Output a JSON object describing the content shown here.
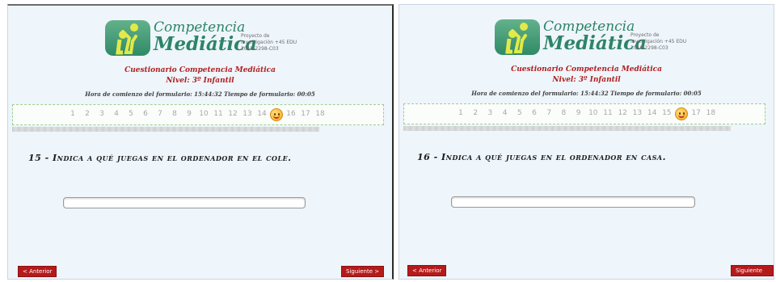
{
  "panels": [
    {
      "logo": {
        "line1": "Competencia",
        "line2": "Mediática",
        "subtitle": "Proyecto de Investigación +45 EDU 2010-2298-C03"
      },
      "questionnaire_title": "Cuestionario Competencia Mediática",
      "level": "Nivel: 3º Infantil",
      "time_line": "Hora de comienzo del formulario: 15:44:32 Tiempo de formulario: 00:05",
      "pages": [
        "1",
        "2",
        "3",
        "4",
        "5",
        "6",
        "7",
        "8",
        "9",
        "10",
        "11",
        "12",
        "13",
        "14",
        "15",
        "16",
        "17",
        "18"
      ],
      "current_page": "15",
      "question": "15 - Indica a qué juegas en el ordenador en el cole.",
      "answer_value": "",
      "prev_label": "< Anterior",
      "next_label": "Siguiente >"
    },
    {
      "logo": {
        "line1": "Competencia",
        "line2": "Mediática",
        "subtitle": "Proyecto de Investigación +45 EDU 2010-2298-C03"
      },
      "questionnaire_title": "Cuestionario Competencia Mediática",
      "level": "Nivel: 3º Infantil",
      "time_line": "Hora de comienzo del formulario: 15:44:32 Tiempo de formulario: 00:05",
      "pages": [
        "1",
        "2",
        "3",
        "4",
        "5",
        "6",
        "7",
        "8",
        "9",
        "10",
        "11",
        "12",
        "13",
        "14",
        "15",
        "16",
        "17",
        "18"
      ],
      "current_page": "16",
      "question": "16 - Indica a qué juegas en el ordenador en casa.",
      "answer_value": "",
      "prev_label": "< Anterior",
      "next_label": "Siguiente >"
    }
  ]
}
